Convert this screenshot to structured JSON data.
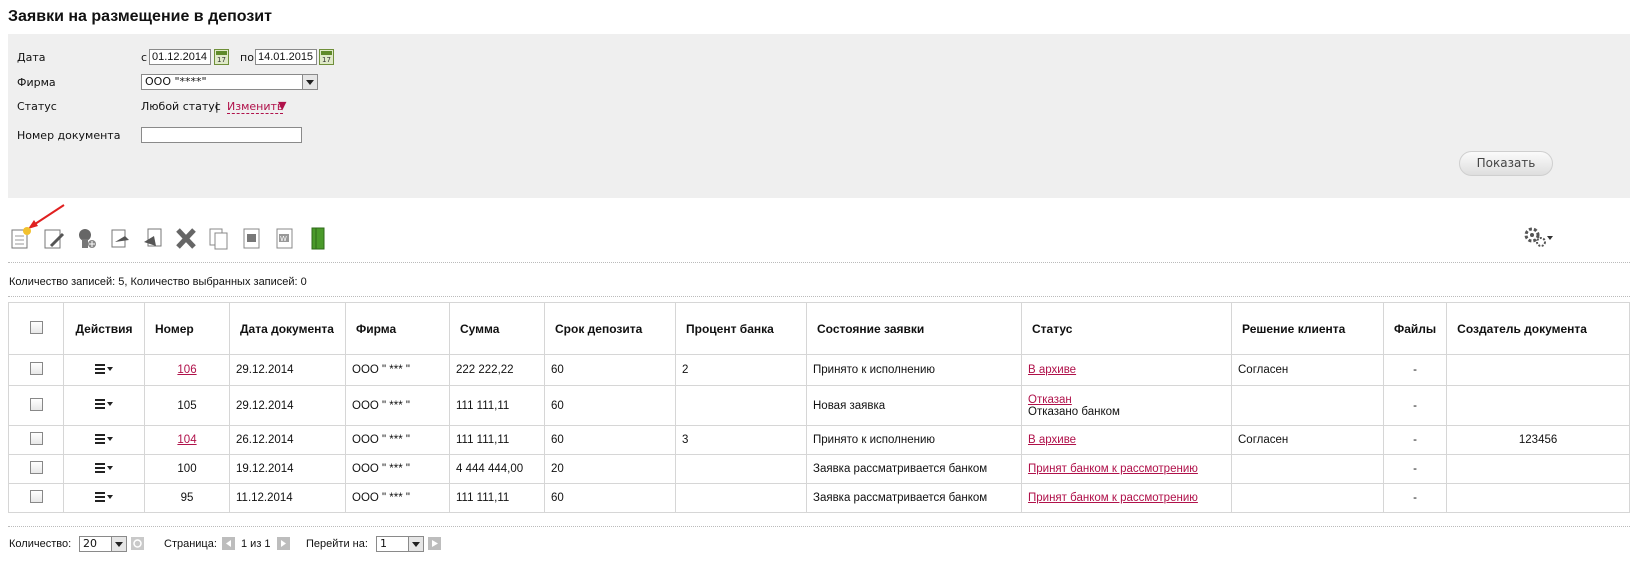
{
  "page": {
    "title": "Заявки на размещение в депозит"
  },
  "filter": {
    "date_label": "Дата",
    "from_label": "с",
    "date_from": "01.12.2014",
    "to_label": "по",
    "date_to": "14.01.2015",
    "calendar_icon_text": "17",
    "firm_label": "Фирма",
    "firm_value": "ООО \"****\"",
    "status_label": "Статус",
    "status_value": "Любой статус",
    "status_separator": "|",
    "status_change_link": "Изменить",
    "status_change_arrow": "▼",
    "docnum_label": "Номер документа",
    "docnum_value": "",
    "show_button": "Показать"
  },
  "toolbar": {
    "icons": [
      "new-document-icon",
      "edit-document-icon",
      "sign-icon",
      "send-icon",
      "recall-icon",
      "delete-icon",
      "copy-icon",
      "export-pdf-icon",
      "export-word-icon",
      "archive-icon"
    ],
    "settings_icon": "gear-icon"
  },
  "summary": "Количество записей: 5, Количество выбранных записей: 0",
  "table": {
    "headers": {
      "actions": "Действия",
      "number": "Номер",
      "date": "Дата документа",
      "firm": "Фирма",
      "sum": "Сумма",
      "term": "Срок депозита",
      "rate": "Процент банка",
      "state": "Состояние заявки",
      "status": "Статус",
      "decision": "Решение клиента",
      "files": "Файлы",
      "creator": "Создатель документа"
    },
    "rows": [
      {
        "number": "106",
        "number_link": true,
        "date": "29.12.2014",
        "firm": "ООО \" *** \"",
        "sum": "222 222,22",
        "term": "60",
        "rate": "2",
        "state": "Принято к исполнению",
        "status": "В архиве",
        "status_note": "",
        "decision": "Согласен",
        "files": "-",
        "creator": ""
      },
      {
        "number": "105",
        "number_link": false,
        "date": "29.12.2014",
        "firm": "ООО \" *** \"",
        "sum": "111 111,11",
        "term": "60",
        "rate": "",
        "state": "Новая заявка",
        "status": "Отказан",
        "status_note": "Отказано банком",
        "decision": "",
        "files": "-",
        "creator": ""
      },
      {
        "number": "104",
        "number_link": true,
        "date": "26.12.2014",
        "firm": "ООО \" *** \"",
        "sum": "111 111,11",
        "term": "60",
        "rate": "3",
        "state": "Принято к исполнению",
        "status": "В архиве",
        "status_note": "",
        "decision": "Согласен",
        "files": "-",
        "creator": "123456"
      },
      {
        "number": "100",
        "number_link": false,
        "date": "19.12.2014",
        "firm": "ООО \" *** \"",
        "sum": "4 444 444,00",
        "term": "20",
        "rate": "",
        "state": "Заявка рассматривается банком",
        "status": "Принят банком к рассмотрению",
        "status_note": "",
        "decision": "",
        "files": "-",
        "creator": ""
      },
      {
        "number": "95",
        "number_link": false,
        "date": "11.12.2014",
        "firm": "ООО \" *** \"",
        "sum": "111 111,11",
        "term": "60",
        "rate": "",
        "state": "Заявка рассматривается банком",
        "status": "Принят банком к рассмотрению",
        "status_note": "",
        "decision": "",
        "files": "-",
        "creator": ""
      }
    ]
  },
  "pager": {
    "count_label": "Количество:",
    "count_value": "20",
    "page_label": "Страница:",
    "page_info": "1 из 1",
    "goto_label": "Перейти на:",
    "goto_value": "1"
  },
  "colors": {
    "link": "#b0114a",
    "filter_bg": "#efefef"
  }
}
